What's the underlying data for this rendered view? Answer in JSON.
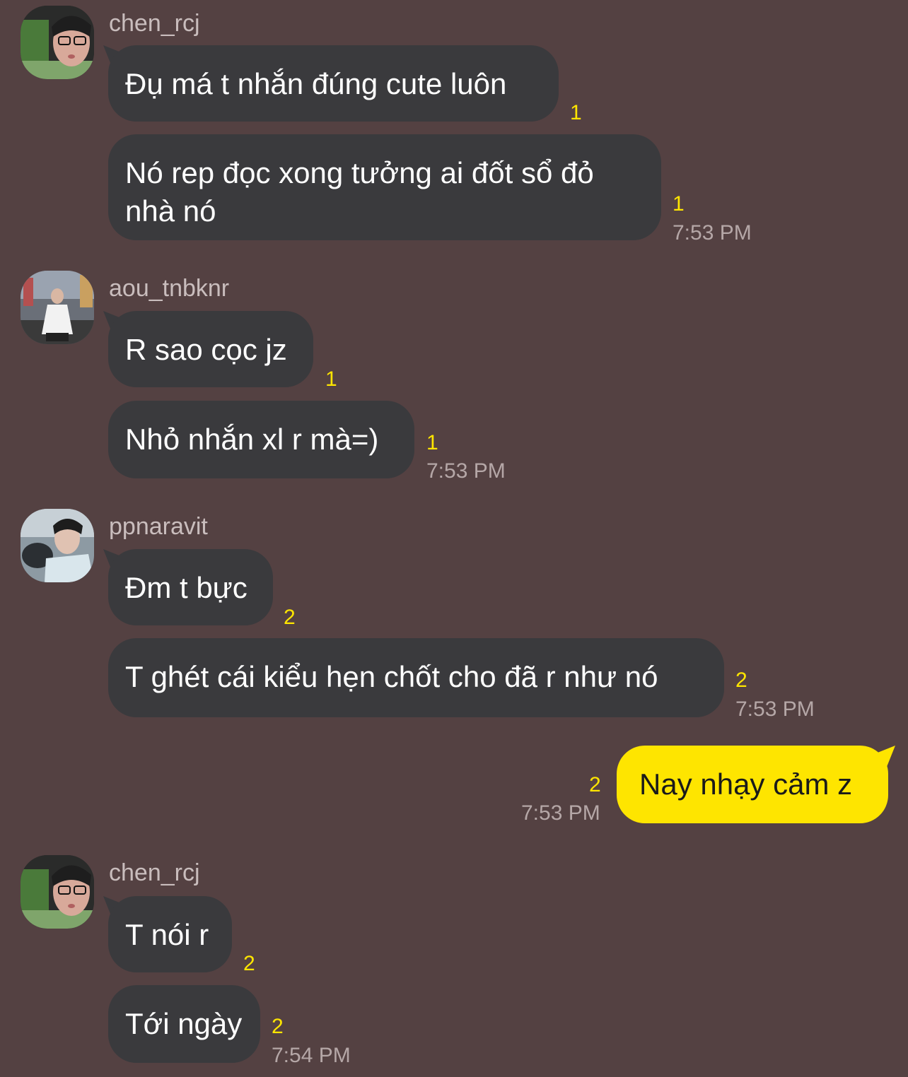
{
  "colors": {
    "background": "#544142",
    "other_bubble": "#3a3a3d",
    "my_bubble": "#fee500",
    "unread_count": "#fee500",
    "timestamp": "#b5a7a7"
  },
  "groups": [
    {
      "sender": "chen_rcj",
      "avatar": "avatar-chen",
      "messages": [
        {
          "text": "Đụ má t nhắn đúng cute luôn",
          "unread": "1"
        },
        {
          "text": "Nó rep đọc xong tưởng ai đốt sổ đỏ nhà nó",
          "unread": "1",
          "time": "7:53 PM"
        }
      ]
    },
    {
      "sender": "aou_tnbknr",
      "avatar": "avatar-aou",
      "messages": [
        {
          "text": "R sao cọc jz",
          "unread": "1"
        },
        {
          "text": "Nhỏ nhắn xl r mà=)",
          "unread": "1",
          "time": "7:53 PM"
        }
      ]
    },
    {
      "sender": "ppnaravit",
      "avatar": "avatar-ppnaravit",
      "messages": [
        {
          "text": "Đm t bực",
          "unread": "2"
        },
        {
          "text": "T ghét cái kiểu hẹn chốt cho đã r như nó",
          "unread": "2",
          "time": "7:53 PM"
        }
      ]
    },
    {
      "sender": "me",
      "messages": [
        {
          "text": "Nay nhạy cảm z",
          "unread": "2",
          "time": "7:53 PM"
        }
      ]
    },
    {
      "sender": "chen_rcj",
      "avatar": "avatar-chen",
      "messages": [
        {
          "text": "T nói r",
          "unread": "2"
        },
        {
          "text": "Tới ngày",
          "unread": "2",
          "time": "7:54 PM"
        }
      ]
    }
  ]
}
